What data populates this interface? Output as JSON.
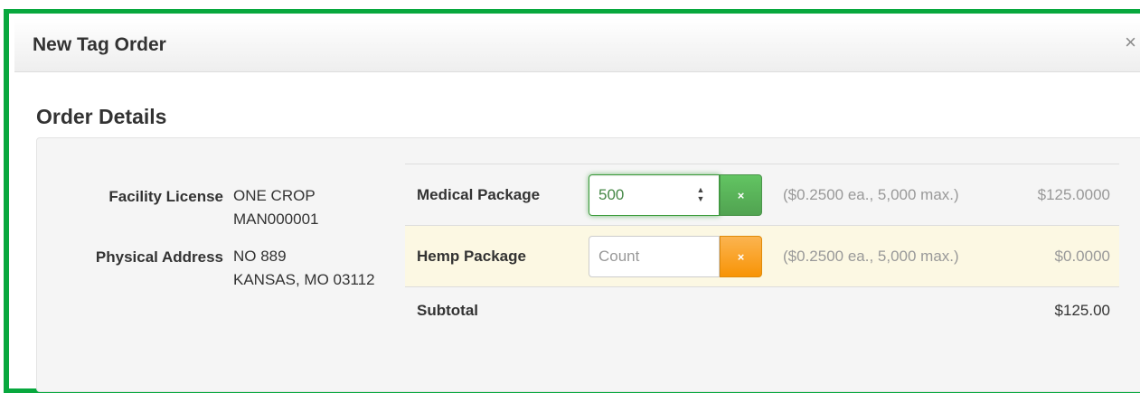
{
  "modal": {
    "title": "New Tag Order",
    "close_label": "×"
  },
  "section": {
    "title": "Order Details"
  },
  "facility": {
    "license_label": "Facility License",
    "license_name": "ONE CROP",
    "license_number": "MAN000001",
    "address_label": "Physical Address",
    "address_line1": "NO 889",
    "address_line2": "KANSAS, MO 03112"
  },
  "order": {
    "rows": [
      {
        "label": "Medical Package",
        "value": "500",
        "placeholder": "Count",
        "clear_label": "×",
        "price_note": "($0.2500 ea., 5,000 max.)",
        "amount": "$125.0000"
      },
      {
        "label": "Hemp Package",
        "value": "",
        "placeholder": "Count",
        "clear_label": "×",
        "price_note": "($0.2500 ea., 5,000 max.)",
        "amount": "$0.0000"
      }
    ],
    "subtotal_label": "Subtotal",
    "subtotal_amount": "$125.00"
  },
  "colors": {
    "frame_accent": "#08a83e",
    "success_button": "#5bb75b",
    "warning_button": "#f89406",
    "warning_row": "#fcf8e3"
  },
  "icons": {
    "close": "close-icon",
    "clear": "clear-icon",
    "spinner": "number-spinner-icon"
  }
}
